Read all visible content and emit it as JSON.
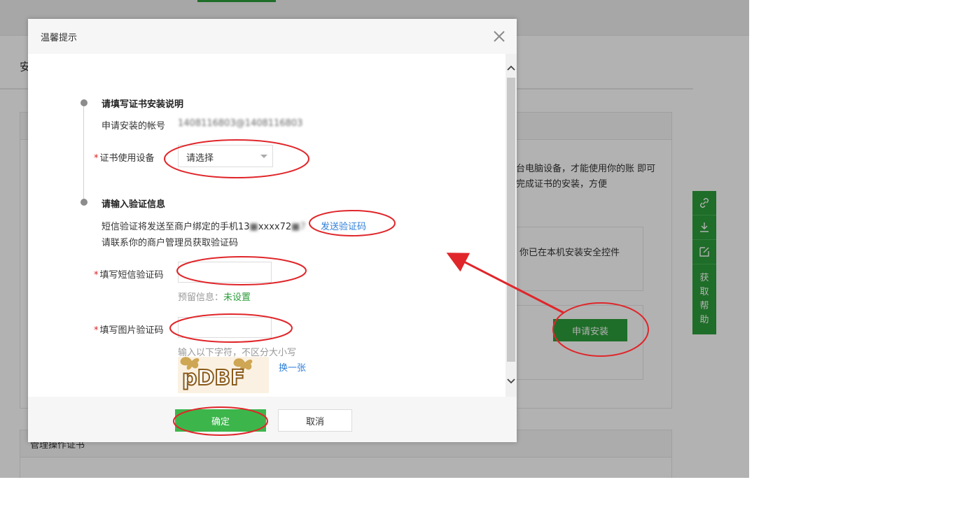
{
  "background": {
    "page_title": "安",
    "card_text": "台电脑设备，才能使用你的账 即可完成证书的安装，方便",
    "security_control_text": "你已在本机安装安全控件",
    "apply_button": "申请安装",
    "card2_title": "管理操作证书",
    "help_label": [
      "获",
      "取",
      "帮",
      "助"
    ]
  },
  "modal": {
    "title": "温馨提示",
    "section1_title": "请填写证书安装说明",
    "account_label": "申请安装的帐号",
    "account_value": "1408116803@1408116803",
    "device_label": "证书使用设备",
    "device_select_value": "请选择",
    "section2_title": "请输入验证信息",
    "sms_notice": "短信验证将发送至商户绑定的手机13",
    "sms_phone_masked": "xxxx72",
    "send_code_link": "发送验证码",
    "contact_admin": "请联系你的商户管理员获取验证码",
    "sms_code_label": "填写短信验证码",
    "sms_code_value": "",
    "reserved_info_label": "预留信息：",
    "reserved_info_value": "未设置",
    "image_code_label": "填写图片验证码",
    "image_code_value": "",
    "captcha_hint": "输入以下字符，不区分大小写",
    "captcha_text": "pDBF",
    "refresh_captcha_link": "换一张",
    "required_mark": "*",
    "ok_button": "确定",
    "cancel_button": "取消"
  },
  "colors": {
    "accent_green": "#2c9c3a",
    "ok_green": "#3cb64b",
    "link_blue": "#2f7fd8",
    "annotation_red": "#e0262a",
    "required_red": "#e02020"
  },
  "icons": [
    "close-icon",
    "scroll-up-icon",
    "scroll-down-icon",
    "link-icon",
    "download-icon",
    "edit-icon"
  ]
}
